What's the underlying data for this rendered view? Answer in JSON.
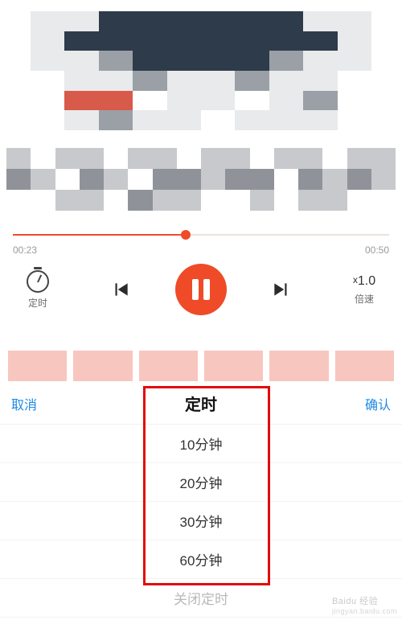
{
  "player": {
    "elapsed": "00:23",
    "duration": "00:50",
    "progress": 0.46,
    "timer_label": "定时",
    "speed_value": "1.0",
    "speed_prefix": "x",
    "speed_label": "倍速"
  },
  "sheet": {
    "cancel": "取消",
    "title": "定时",
    "confirm": "确认",
    "options": [
      "10分钟",
      "20分钟",
      "30分钟",
      "60分钟"
    ],
    "close": "关闭定时"
  },
  "watermark": {
    "brand": "Baidu 经验",
    "url": "jingyan.baidu.com"
  }
}
